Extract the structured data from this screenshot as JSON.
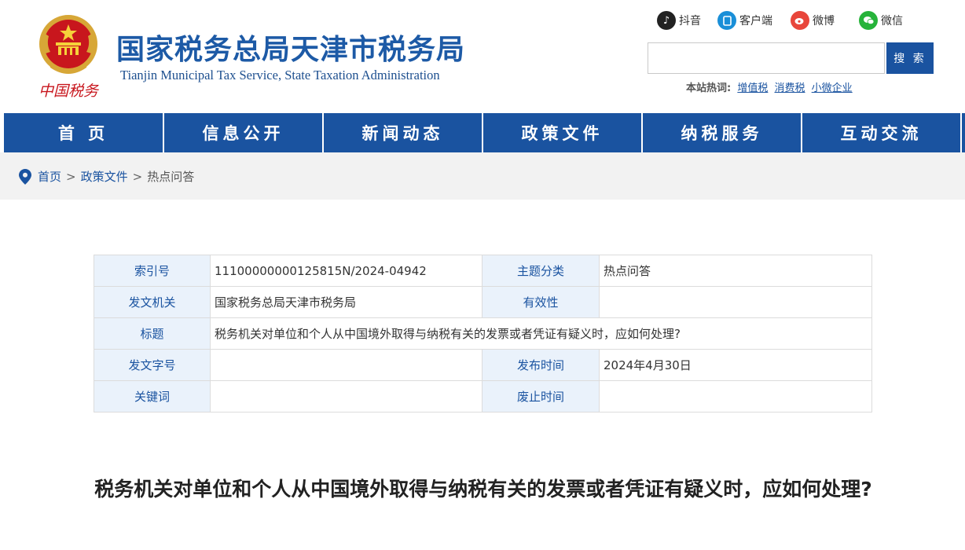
{
  "header": {
    "emblem_text": "中国税务",
    "title": "国家税务总局天津市税务局",
    "subtitle": "Tianjin Municipal Tax Service, State Taxation Administration",
    "social": [
      {
        "icon": "douyin-icon",
        "label": "抖音",
        "color": "#222222"
      },
      {
        "icon": "client-icon",
        "label": "客户端",
        "color": "#1a8fd8"
      },
      {
        "icon": "weibo-icon",
        "label": "微博",
        "color": "#e8463b"
      },
      {
        "icon": "wechat-icon",
        "label": "微信",
        "color": "#26b33a"
      }
    ],
    "search": {
      "placeholder": "",
      "value": "",
      "button_label": "搜 索"
    },
    "hot": {
      "label": "本站热词:",
      "words": [
        "增值税",
        "消费税",
        "小微企业"
      ]
    }
  },
  "nav": {
    "items": [
      "首 页",
      "信息公开",
      "新闻动态",
      "政策文件",
      "纳税服务",
      "互动交流"
    ]
  },
  "breadcrumb": {
    "items": [
      "首页",
      "政策文件"
    ],
    "separator": ">",
    "current": "热点问答"
  },
  "meta_table": {
    "rows": [
      [
        {
          "k": "索引号",
          "v": "11100000000125815N/2024-04942"
        },
        {
          "k": "主题分类",
          "v": "热点问答"
        }
      ],
      [
        {
          "k": "发文机关",
          "v": "国家税务总局天津市税务局"
        },
        {
          "k": "有效性",
          "v": ""
        }
      ],
      [
        {
          "k": "标题",
          "v": "税务机关对单位和个人从中国境外取得与纳税有关的发票或者凭证有疑义时，应如何处理?"
        }
      ],
      [
        {
          "k": "发文字号",
          "v": ""
        },
        {
          "k": "发布时间",
          "v": "2024年4月30日"
        }
      ],
      [
        {
          "k": "关键词",
          "v": ""
        },
        {
          "k": "废止时间",
          "v": ""
        }
      ]
    ]
  },
  "article": {
    "title": "税务机关对单位和个人从中国境外取得与纳税有关的发票或者凭证有疑义时，应如何处理?"
  },
  "colors": {
    "brand_blue": "#1a53a0",
    "title_blue": "#1d5aa6",
    "label_bg": "#eaf2fb",
    "crumb_bg": "#f2f2f2"
  }
}
